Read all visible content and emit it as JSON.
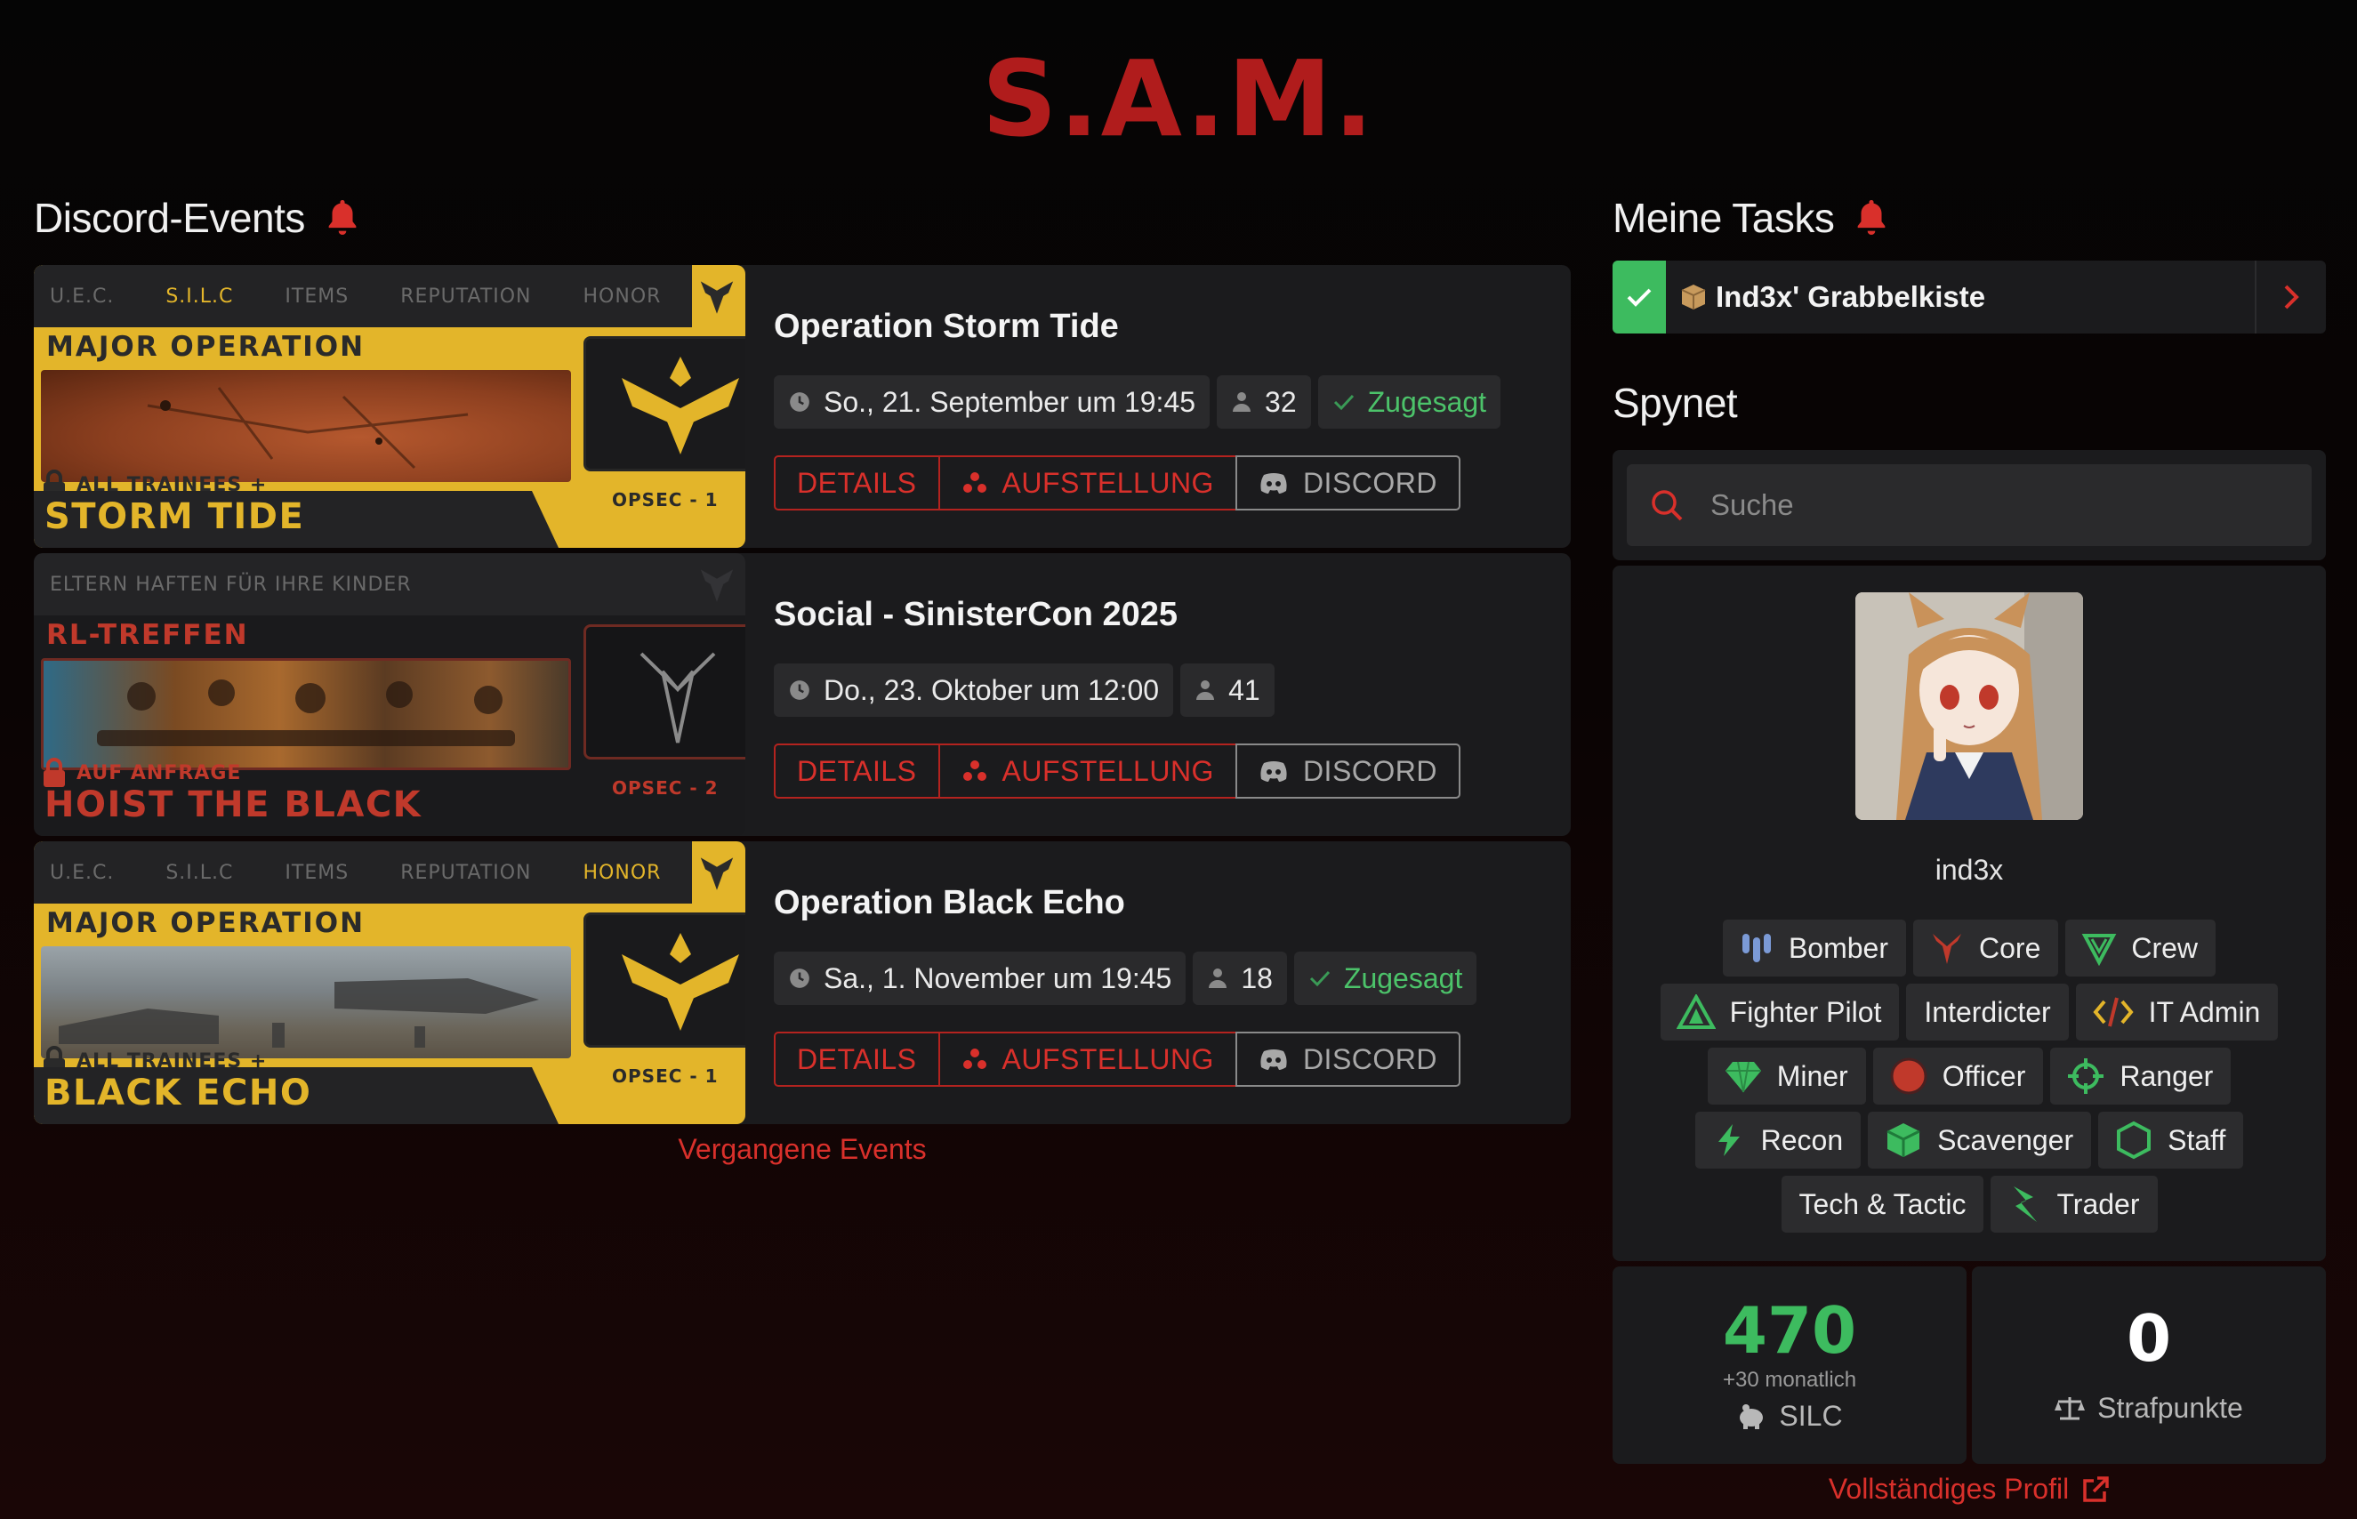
{
  "brand": "S.A.M.",
  "events_section": {
    "title": "Discord-Events",
    "past_link": "Vergangene Events"
  },
  "events": [
    {
      "banner": {
        "tabs": [
          "U.E.C.",
          "S.I.L.C",
          "ITEMS",
          "REPUTATION",
          "HONOR"
        ],
        "highlight_tab": "S.I.L.C",
        "kicker": "MAJOR OPERATION",
        "access": "ALL TRAINEES +",
        "name": "STORM TIDE",
        "opsec": "OPSEC - 1",
        "style": "gold"
      },
      "title": "Operation Storm Tide",
      "date": "So., 21. September um 19:45",
      "attendees": "32",
      "status": "Zugesagt",
      "buttons": {
        "details": "DETAILS",
        "lineup": "AUFSTELLUNG",
        "discord": "DISCORD"
      }
    },
    {
      "banner": {
        "tabs": [
          "ELTERN HAFTEN FÜR IHRE KINDER"
        ],
        "highlight_tab": "",
        "kicker": "RL-TREFFEN",
        "access": "AUF ANFRAGE",
        "name": "HOIST THE BLACK",
        "opsec": "OPSEC - 2",
        "style": "dark"
      },
      "title": "Social - SinisterCon 2025",
      "date": "Do., 23. Oktober um 12:00",
      "attendees": "41",
      "status": "",
      "buttons": {
        "details": "DETAILS",
        "lineup": "AUFSTELLUNG",
        "discord": "DISCORD"
      }
    },
    {
      "banner": {
        "tabs": [
          "U.E.C.",
          "S.I.L.C",
          "ITEMS",
          "REPUTATION",
          "HONOR"
        ],
        "highlight_tab": "HONOR",
        "kicker": "MAJOR OPERATION",
        "access": "ALL TRAINEES +",
        "name": "BLACK ECHO",
        "opsec": "OPSEC - 1",
        "style": "gold"
      },
      "title": "Operation Black Echo",
      "date": "Sa., 1. November um 19:45",
      "attendees": "18",
      "status": "Zugesagt",
      "buttons": {
        "details": "DETAILS",
        "lineup": "AUFSTELLUNG",
        "discord": "DISCORD"
      }
    }
  ],
  "tasks_section": {
    "title": "Meine Tasks"
  },
  "task": {
    "label": "Ind3x' Grabbelkiste",
    "icon": "package-icon",
    "done": true
  },
  "spynet": {
    "title": "Spynet",
    "search_placeholder": "Suche"
  },
  "profile": {
    "username": "ind3x",
    "roles": [
      [
        "Bomber",
        "Core",
        "Crew"
      ],
      [
        "Fighter Pilot",
        "Interdicter",
        "IT Admin"
      ],
      [
        "Miner",
        "Officer",
        "Ranger"
      ],
      [
        "Recon",
        "Scavenger",
        "Staff"
      ],
      [
        "Tech & Tactic",
        "Trader"
      ]
    ],
    "silc": {
      "value": "470",
      "monthly": "+30 monatlich",
      "label": "SILC"
    },
    "penalty": {
      "value": "0",
      "label": "Strafpunkte"
    },
    "full_profile_link": "Vollständiges Profil"
  },
  "colors": {
    "accent": "#d9302b",
    "brand": "#b01c1c",
    "success": "#3dbb5f",
    "gold": "#e3b52a",
    "card": "#1b1b1d"
  }
}
